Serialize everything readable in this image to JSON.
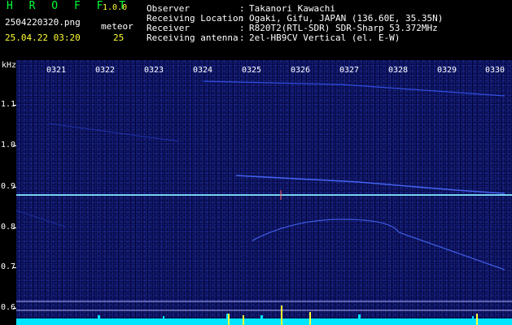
{
  "header": {
    "brand": "H R O F F T",
    "version": "1.0.0",
    "filename": "2504220320.png",
    "datetime": "25.04.22 03:20",
    "meteor_label": "meteor",
    "meteor_count": "25"
  },
  "info": {
    "observer_key": "Observer",
    "observer_val": "Takanori Kawachi",
    "location_key": "Receiving Location",
    "location_val": "Ogaki, Gifu, JAPAN (136.60E, 35.35N)",
    "receiver_key": "Receiver",
    "receiver_val": "R820T2(RTL-SDR) SDR-Sharp 53.372MHz",
    "antenna_key": "Receiving antenna",
    "antenna_val": "2el-HB9CV Vertical (el. E-W)",
    "separator": ":"
  },
  "axis": {
    "y_unit": "kHz",
    "y_ticks": [
      "1.1",
      "1.0",
      "0.9",
      "0.8",
      "0.7",
      "0.6"
    ],
    "x_ticks": [
      "0321",
      "0322",
      "0323",
      "0324",
      "0325",
      "0326",
      "0327",
      "0328",
      "0329",
      "0330"
    ]
  },
  "colors": {
    "header_green": "#00ff3a",
    "header_yellow": "#ffff32",
    "background_noise": "#02022e",
    "carrier_line": "#7fdcff",
    "trace": "#4a6cff",
    "level_bar": "#00e5ff"
  }
}
